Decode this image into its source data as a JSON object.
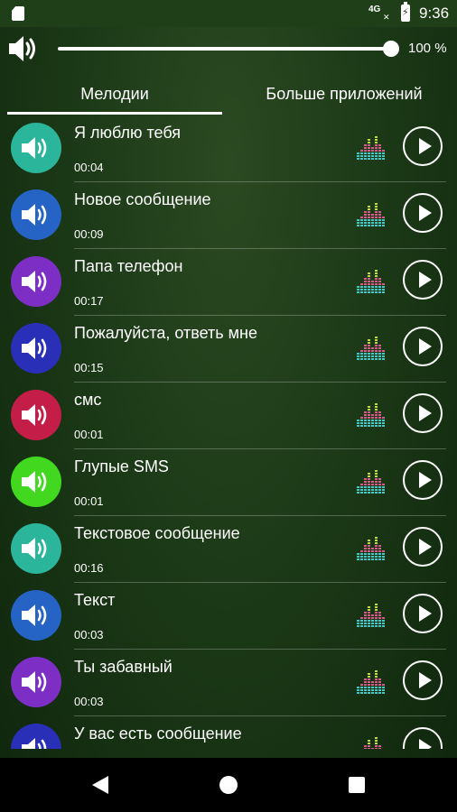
{
  "status_bar": {
    "network": "4G",
    "time": "9:36"
  },
  "volume": {
    "percent_label": "100 %",
    "level": 1.0
  },
  "tabs": [
    {
      "label": "Мелодии",
      "active": true
    },
    {
      "label": "Больше приложений",
      "active": false
    }
  ],
  "ringtones": [
    {
      "title": "Я люблю тебя",
      "duration": "00:04",
      "color": "#2bb59a"
    },
    {
      "title": "Новое сообщение",
      "duration": "00:09",
      "color": "#2563c4"
    },
    {
      "title": "Папа телефон",
      "duration": "00:17",
      "color": "#7d2fc5"
    },
    {
      "title": "Пожалуйста, ответь мне",
      "duration": "00:15",
      "color": "#2a2fb8"
    },
    {
      "title": "смс",
      "duration": "00:01",
      "color": "#c41e48"
    },
    {
      "title": "Глупые SMS",
      "duration": "00:01",
      "color": "#41d81f"
    },
    {
      "title": "Текстовое сообщение",
      "duration": "00:16",
      "color": "#2bb59a"
    },
    {
      "title": "Текст",
      "duration": "00:03",
      "color": "#2563c4"
    },
    {
      "title": "Ты забавный",
      "duration": "00:03",
      "color": "#7d2fc5"
    },
    {
      "title": "У вас есть сообщение",
      "duration": "",
      "color": "#2a2fb8"
    }
  ],
  "icons": {
    "speaker": "speaker-icon",
    "equalizer": "equalizer-icon",
    "play": "play-icon"
  }
}
